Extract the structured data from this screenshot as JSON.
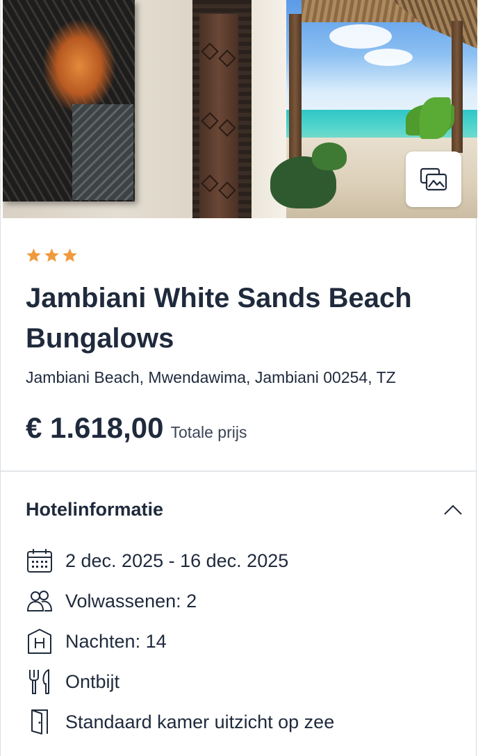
{
  "hotel": {
    "stars": 3,
    "star_color": "#f09a3e",
    "name": "Jambiani White Sands Beach Bungalows",
    "address": "Jambiani Beach, Mwendawima, Jambiani 00254, TZ",
    "price": "€ 1.618,00",
    "price_label": "Totale prijs"
  },
  "gallery_button": {
    "icon": "gallery-icon"
  },
  "info_section": {
    "title": "Hotelinformatie",
    "toggle_icon": "chevron-up-icon",
    "items": [
      {
        "icon": "calendar-icon",
        "text": "2 dec. 2025 - 16 dec. 2025"
      },
      {
        "icon": "adults-icon",
        "text": "Volwassenen: 2"
      },
      {
        "icon": "hotel-icon",
        "text": "Nachten: 14"
      },
      {
        "icon": "cutlery-icon",
        "text": "Ontbijt"
      },
      {
        "icon": "door-icon",
        "text": "Standaard kamer uitzicht op zee"
      }
    ]
  },
  "colors": {
    "text_primary": "#1f2a3c",
    "divider": "#e3e6ea"
  }
}
